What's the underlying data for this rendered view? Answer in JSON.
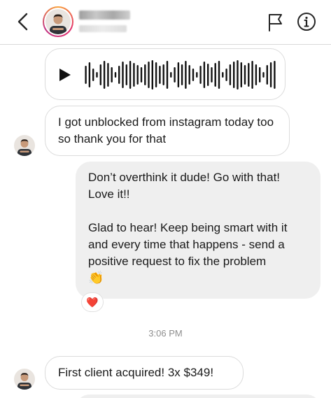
{
  "header": {
    "back_icon": "chevron-left-icon",
    "flag_icon": "flag-icon",
    "info_icon": "info-icon"
  },
  "messages": {
    "voice": {
      "play_icon": "play-icon"
    },
    "received_1": "I got unblocked from instagram today too so thank you for that",
    "sent_1": {
      "line1": "Don’t overthink it dude! Go with that! Love it!!",
      "line2": "Glad to hear! Keep being smart with it and every time that happens - send a positive request to fix the problem",
      "emoji": "👏",
      "reaction": "❤️"
    },
    "timestamp": "3:06 PM",
    "received_2": "First client acquired! 3x $349!"
  },
  "colors": {
    "bubble_out": "#efefef",
    "bubble_in_border": "#dbdbdb",
    "timestamp": "#8e8e8e",
    "reaction_heart": "#e0245e"
  }
}
